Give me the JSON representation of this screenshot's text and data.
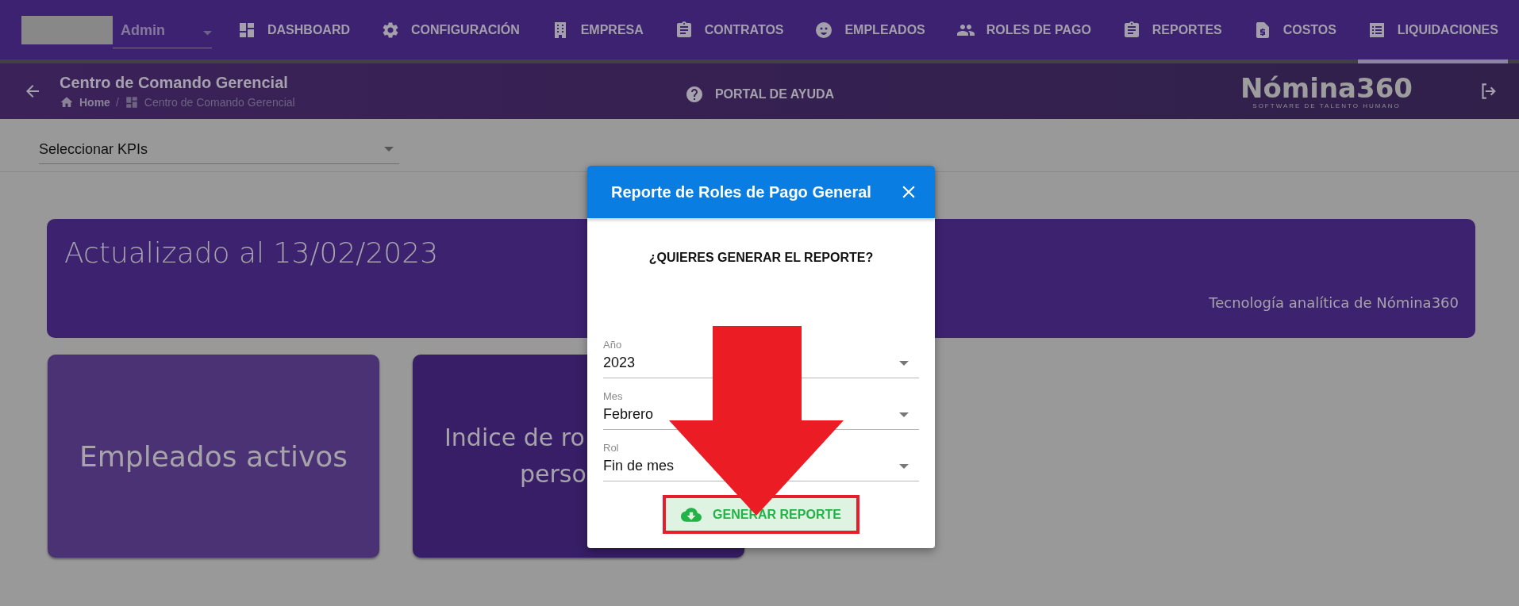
{
  "nav": {
    "user": "Admin",
    "tabs": [
      {
        "label": "DASHBOARD",
        "selected": false
      },
      {
        "label": "CONFIGURACIÓN",
        "selected": false
      },
      {
        "label": "EMPRESA",
        "selected": false
      },
      {
        "label": "CONTRATOS",
        "selected": false
      },
      {
        "label": "EMPLEADOS",
        "selected": false
      },
      {
        "label": "ROLES DE PAGO",
        "selected": false
      },
      {
        "label": "REPORTES",
        "selected": false
      },
      {
        "label": "COSTOS",
        "selected": false
      },
      {
        "label": "LIQUIDACIONES",
        "selected": true
      }
    ]
  },
  "header": {
    "title": "Centro de Comando Gerencial",
    "breadcrumb": [
      "Home",
      "/",
      "Centro de Comando Gerencial"
    ],
    "help_link": "PORTAL DE AYUDA",
    "logo": "Nómina360",
    "logo_tagline": "SOFTWARE DE TALENTO HUMANO"
  },
  "kpi_select": {
    "label": "Seleccionar KPIs"
  },
  "banner": {
    "title": "Actualizado al 13/02/2023",
    "subtitle": "Tecnología analítica de Nómina360"
  },
  "cards": [
    {
      "lines": [
        "Empleados activos"
      ]
    },
    {
      "lines": [
        "Indice de ro",
        "perso"
      ]
    }
  ],
  "dialog": {
    "title": "Reporte de Roles de Pago General",
    "question": "¿QUIERES GENERAR EL REPORTE?",
    "fields": [
      {
        "label": "Año",
        "value": "2023"
      },
      {
        "label": "Mes",
        "value": "Febrero"
      },
      {
        "label": "Rol",
        "value": "Fin de mes"
      }
    ],
    "button": "GENERAR REPORTE"
  },
  "annotation": {
    "arrow": true,
    "button_frame": true
  }
}
